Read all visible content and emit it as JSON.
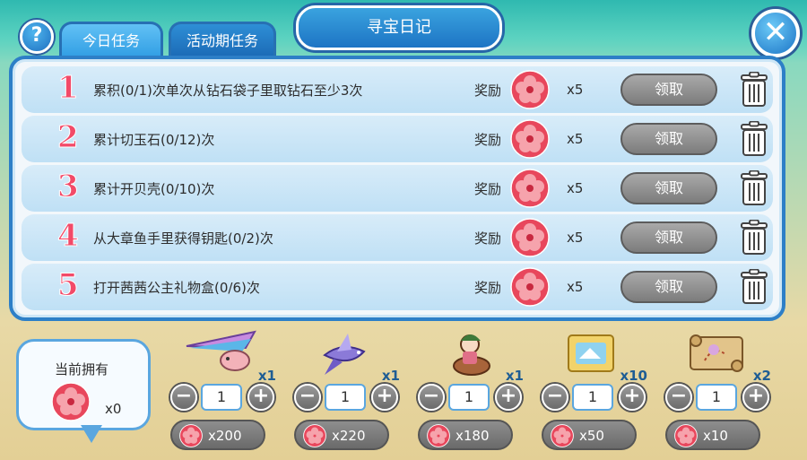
{
  "header": {
    "help_label": "?",
    "tabs": [
      {
        "label": "今日任务",
        "active": true
      },
      {
        "label": "活动期任务",
        "active": false
      }
    ],
    "title": "寻宝日记",
    "close_label": "✕"
  },
  "tasks": [
    {
      "num": "1",
      "text": "累积(0/1)次单次从钻石袋子里取钻石至少3次",
      "reward_label": "奖励",
      "reward_icon": "flower-coin-icon",
      "reward_count": "x5",
      "claim_label": "领取"
    },
    {
      "num": "2",
      "text": "累计切玉石(0/12)次",
      "reward_label": "奖励",
      "reward_icon": "flower-coin-icon",
      "reward_count": "x5",
      "claim_label": "领取"
    },
    {
      "num": "3",
      "text": "累计开贝壳(0/10)次",
      "reward_label": "奖励",
      "reward_icon": "flower-coin-icon",
      "reward_count": "x5",
      "claim_label": "领取"
    },
    {
      "num": "4",
      "text": "从大章鱼手里获得钥匙(0/2)次",
      "reward_label": "奖励",
      "reward_icon": "flower-coin-icon",
      "reward_count": "x5",
      "claim_label": "领取"
    },
    {
      "num": "5",
      "text": "打开茜茜公主礼物盒(0/6)次",
      "reward_label": "奖励",
      "reward_icon": "flower-coin-icon",
      "reward_count": "x5",
      "claim_label": "领取"
    }
  ],
  "owned": {
    "label": "当前拥有",
    "count": "x0"
  },
  "shop": [
    {
      "icon": "hang-glider-icon",
      "mult": "x1",
      "qty": "1",
      "price": "x200"
    },
    {
      "icon": "flying-fish-icon",
      "mult": "x1",
      "qty": "1",
      "price": "x220"
    },
    {
      "icon": "rider-avatar-icon",
      "mult": "x1",
      "qty": "1",
      "price": "x180"
    },
    {
      "icon": "puzzle-tiles-icon",
      "mult": "x10",
      "qty": "1",
      "price": "x50"
    },
    {
      "icon": "treasure-map-icon",
      "mult": "x2",
      "qty": "1",
      "price": "x10"
    }
  ],
  "colors": {
    "accent": "#2d7fc7",
    "task_number": "#f24a68",
    "flower": "#e8475c"
  }
}
